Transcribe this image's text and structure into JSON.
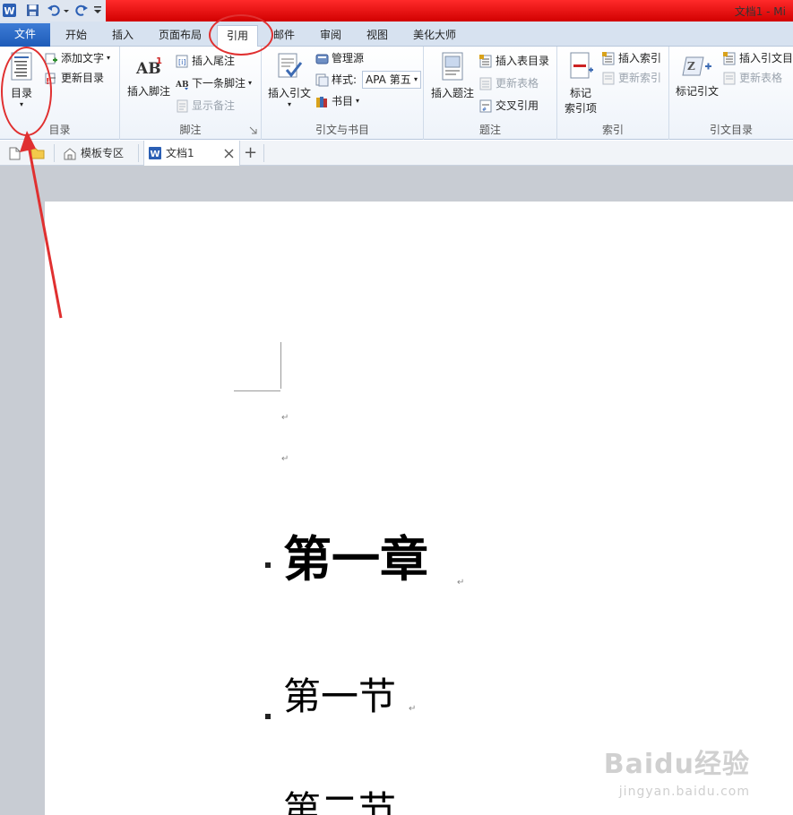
{
  "titlebar": {
    "app_icon": "word-logo-icon",
    "qat": [
      "save-icon",
      "undo-icon",
      "redo-icon",
      "customize-qat-icon"
    ],
    "title": "文档1 - Mi"
  },
  "tabs": [
    {
      "label": "文件"
    },
    {
      "label": "开始"
    },
    {
      "label": "插入"
    },
    {
      "label": "页面布局"
    },
    {
      "label": "引用"
    },
    {
      "label": "邮件"
    },
    {
      "label": "审阅"
    },
    {
      "label": "视图"
    },
    {
      "label": "美化大师"
    }
  ],
  "ribbon": {
    "toc": {
      "group": "目录",
      "toc_button": "目录",
      "add_text": "添加文字",
      "update_toc": "更新目录"
    },
    "footnotes": {
      "group": "脚注",
      "insert_footnote": "插入脚注",
      "insert_endnote": "插入尾注",
      "next_footnote": "下一条脚注",
      "show_notes": "显示备注"
    },
    "citations": {
      "group": "引文与书目",
      "insert_citation": "插入引文",
      "manage_sources": "管理源",
      "style_label": "样式:",
      "style_value": "APA 第五",
      "bibliography": "书目"
    },
    "captions": {
      "group": "题注",
      "insert_caption": "插入题注",
      "insert_table_of_figures": "插入表目录",
      "update_table": "更新表格",
      "cross_reference": "交叉引用"
    },
    "index": {
      "group": "索引",
      "mark_entry_line1": "标记",
      "mark_entry_line2": "索引项",
      "insert_index": "插入索引",
      "update_index": "更新索引"
    },
    "authorities": {
      "group": "引文目录",
      "mark_citation": "标记引文",
      "insert_table_of_authorities": "插入引文目",
      "update_table": "更新表格"
    }
  },
  "doc_tabs": {
    "template_zone": "模板专区",
    "doc_name": "文档1",
    "add": "+"
  },
  "document": {
    "paragraph_mark": "↵",
    "h1": "第一章",
    "h2a": "第一节",
    "h2b": "第二节"
  },
  "watermark": {
    "main": "Baidu经验",
    "sub": "jingyan.baidu.com"
  },
  "colors": {
    "annotation": "#e03030",
    "title_red": "#e00000",
    "file_tab": "#2b66c4"
  }
}
